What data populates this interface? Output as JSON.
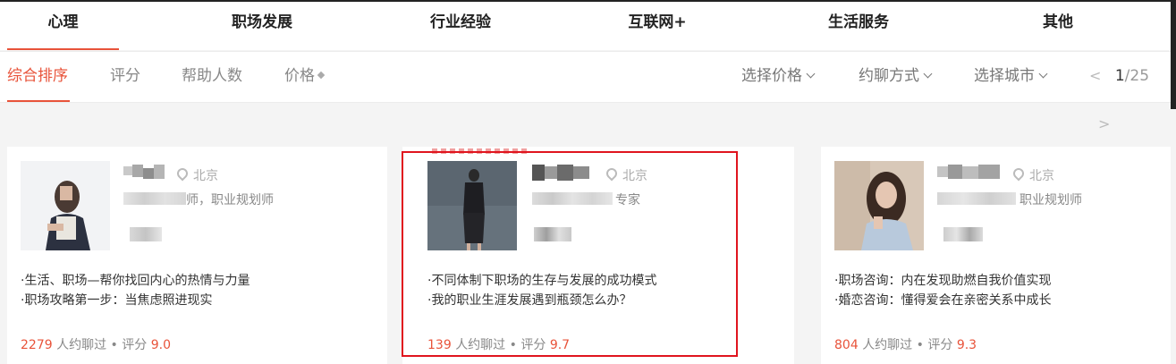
{
  "categories": [
    "心理",
    "职场发展",
    "行业经验",
    "互联网+",
    "生活服务",
    "其他"
  ],
  "active_category": "心理",
  "sort_options": [
    "综合排序",
    "评分",
    "帮助人数",
    "价格"
  ],
  "active_sort": "综合排序",
  "filters": [
    "选择价格",
    "约聊方式",
    "选择城市"
  ],
  "pager": {
    "prev": "<",
    "current": "1",
    "separator": "/",
    "total": "25",
    "next": ">"
  },
  "cards": [
    {
      "city": "北京",
      "title_suffix": "师，职业规划师",
      "topics": [
        "·生活、职场—帮你找回内心的热情与力量",
        "·职场攻略第一步：当焦虑照进现实"
      ],
      "count": "2279",
      "count_label": "人约聊过",
      "dot": "•",
      "score_label": "评分",
      "score": "9.0"
    },
    {
      "city": "北京",
      "title_suffix": "专家",
      "topics": [
        "·不同体制下职场的生存与发展的成功模式",
        "·我的职业生涯发展遇到瓶颈怎么办？"
      ],
      "count": "139",
      "count_label": "人约聊过",
      "dot": "•",
      "score_label": "评分",
      "score": "9.7"
    },
    {
      "city": "北京",
      "title_suffix": "职业规划师",
      "topics": [
        "·职场咨询：内在发现助燃自我价值实现",
        "·婚恋咨询：懂得爱会在亲密关系中成长"
      ],
      "count": "804",
      "count_label": "人约聊过",
      "dot": "•",
      "score_label": "评分",
      "score": "9.3"
    }
  ],
  "colors": {
    "accent": "#e8533a",
    "highlight": "#e0141e"
  },
  "icons": {
    "location": "map-pin-icon",
    "dropdown": "chevron-down-icon",
    "price_sort": "diamond-sort-icon"
  }
}
